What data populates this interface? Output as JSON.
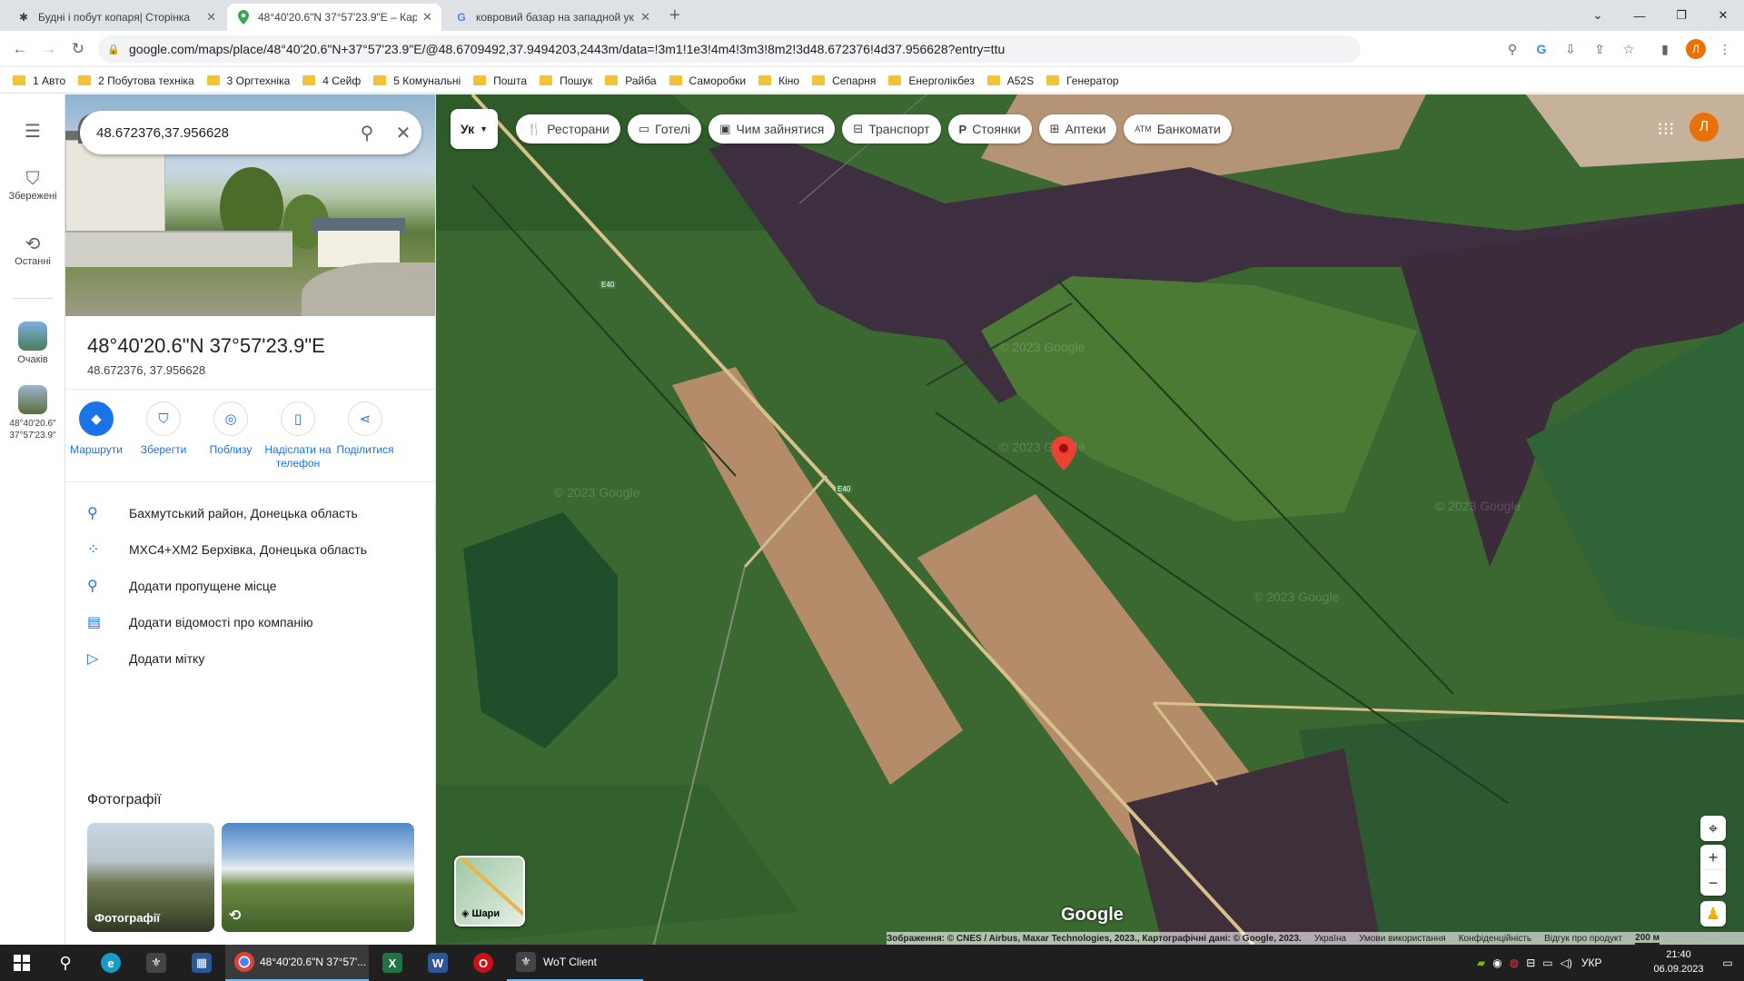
{
  "tabs": [
    {
      "title": "Будні і побут копаря| Сторінка",
      "icon": "forum-icon"
    },
    {
      "title": "48°40'20.6\"N 37°57'23.9\"E – Карт",
      "icon": "maps-pin-icon"
    },
    {
      "title": "ковровий базар на западной ук",
      "icon": "google-g-icon"
    }
  ],
  "address_bar": {
    "url": "google.com/maps/place/48°40'20.6\"N+37°57'23.9\"E/@48.6709492,37.9494203,2443m/data=!3m1!1e3!4m4!3m3!8m2!3d48.672376!4d37.956628?entry=ttu"
  },
  "profile_initial": "Л",
  "bookmarks": [
    "1 Авто",
    "2 Побутова техніка",
    "3 Оргтехніка",
    "4 Сейф",
    "5 Комунальні",
    "Пошта",
    "Пошук",
    "Райба",
    "Саморобки",
    "Кіно",
    "Сепарня",
    "Енерголікбез",
    "A52S",
    "Генератор"
  ],
  "rail": {
    "saved": "Збережені",
    "recent": "Останні",
    "item1": "Очаків",
    "item2": "48°40'20.6\" 37°57'23.9\""
  },
  "search": {
    "value": "48.672376,37.956628"
  },
  "place": {
    "title": "48°40'20.6\"N 37°57'23.9\"E",
    "subtitle": "48.672376, 37.956628"
  },
  "actions": [
    {
      "label": "Маршрути",
      "icon": "directions-icon"
    },
    {
      "label": "Зберегти",
      "icon": "bookmark-icon"
    },
    {
      "label": "Поблизу",
      "icon": "nearby-icon"
    },
    {
      "label": "Надіслати на телефон",
      "icon": "send-to-phone-icon"
    },
    {
      "label": "Поділитися",
      "icon": "share-icon"
    }
  ],
  "info_rows": [
    {
      "text": "Бахмутський район, Донецька область",
      "icon": "location-pin-icon"
    },
    {
      "text": "MXC4+XM2 Берхівка, Донецька область",
      "icon": "plus-code-icon"
    },
    {
      "text": "Додати пропущене місце",
      "icon": "add-place-icon"
    },
    {
      "text": "Додати відомості про компанію",
      "icon": "add-business-icon"
    },
    {
      "text": "Додати мітку",
      "icon": "label-icon"
    }
  ],
  "photos": {
    "heading": "Фотографії",
    "caption": "Фотографії"
  },
  "map": {
    "language_chip": "Ук",
    "chips": [
      {
        "label": "Ресторани",
        "icon": "restaurant-icon"
      },
      {
        "label": "Готелі",
        "icon": "hotel-icon"
      },
      {
        "label": "Чим зайнятися",
        "icon": "camera-icon"
      },
      {
        "label": "Транспорт",
        "icon": "transit-icon"
      },
      {
        "label": "Стоянки",
        "icon": "parking-icon"
      },
      {
        "label": "Аптеки",
        "icon": "pharmacy-icon"
      },
      {
        "label": "Банкомати",
        "icon": "atm-icon"
      }
    ],
    "road_label": "E40",
    "layers_label": "Шари",
    "google_logo": "Google",
    "watermark": "© 2023 Google",
    "avatar_initial": "Л",
    "attribution": [
      "Зображення: © CNES / Airbus, Maxar Technologies, 2023., Картографічні дані: © Google, 2023.",
      "Україна",
      "Умови використання",
      "Конфіденційність",
      "Відгук про продукт",
      "200 м"
    ]
  },
  "taskbar": {
    "chrome_label": "48°40'20.6\"N 37°57'...",
    "wot_label": "WoT Client",
    "lang": "УКР",
    "time": "21:40",
    "date": "06.09.2023"
  }
}
